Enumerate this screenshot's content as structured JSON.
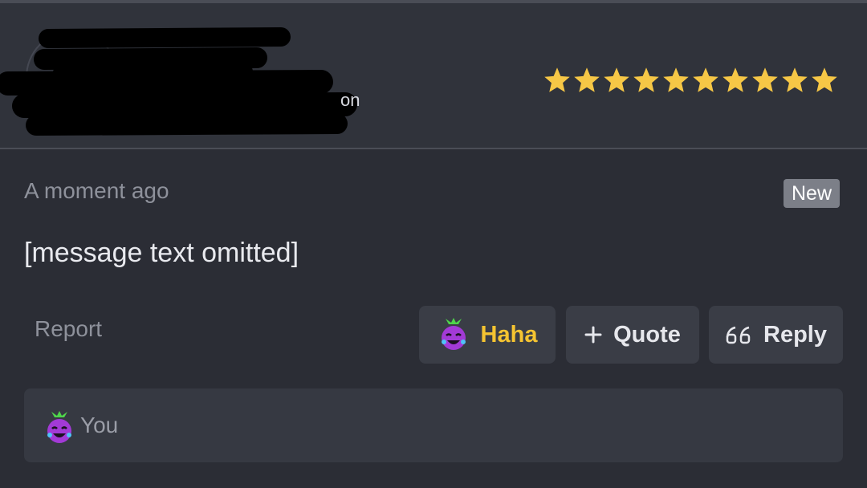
{
  "header": {
    "username_visible_fragment": "on",
    "rating_stars": 10
  },
  "post": {
    "timestamp": "A moment ago",
    "badge": "New",
    "message": "[message text omitted]",
    "report_label": "Report"
  },
  "actions": {
    "haha_label": "Haha",
    "quote_label": "Quote",
    "reply_label": "Reply"
  },
  "reactions": {
    "reactor": "You",
    "icon": "laughing-eggplant-emoji"
  },
  "colors": {
    "background": "#2b2d35",
    "header": "#30333b",
    "button": "#3a3d46",
    "haha_accent": "#f5c431",
    "star": "#f6c746",
    "badge": "#7c7f88"
  }
}
